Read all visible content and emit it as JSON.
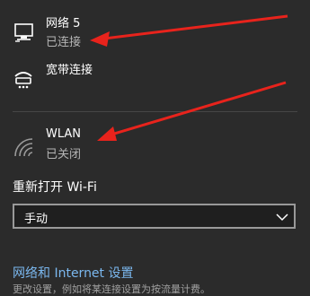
{
  "networks": [
    {
      "name": "网络 5",
      "status": "已连接",
      "icon": "ethernet-icon"
    },
    {
      "name": "宽带连接",
      "status": "",
      "icon": "dialup-icon"
    },
    {
      "name": "WLAN",
      "status": "已关闭",
      "icon": "wifi-off-icon"
    }
  ],
  "wifi_toggle": {
    "label": "重新打开 Wi-Fi",
    "selected": "手动"
  },
  "footer": {
    "link": "网络和 Internet 设置",
    "description": "更改设置，例如将某连接设置为按流量计费。"
  },
  "colors": {
    "background": "#2b2b2b",
    "link": "#7bb8ef",
    "annotation_arrow": "#e8231c"
  }
}
